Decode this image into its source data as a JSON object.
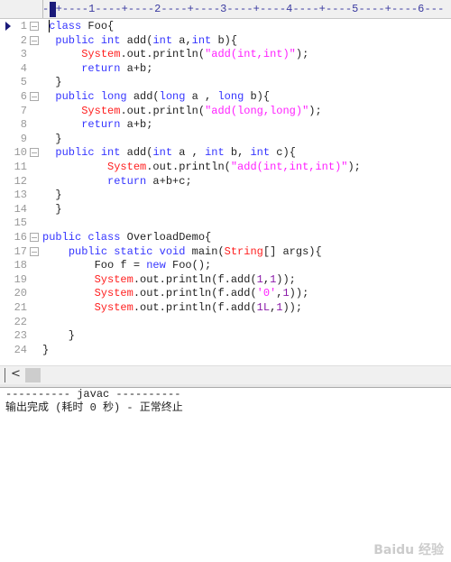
{
  "ruler": {
    "text": "--+----1----+----2----+----3----+----4----+----5----+----6---"
  },
  "editor": {
    "current_line": 1,
    "lines": [
      {
        "n": "1",
        "fold": true,
        "tokens": [
          [
            "t",
            " "
          ],
          [
            "k",
            "class"
          ],
          [
            "t",
            " Foo{"
          ]
        ]
      },
      {
        "n": "2",
        "fold": true,
        "tokens": [
          [
            "t",
            "  "
          ],
          [
            "k",
            "public int"
          ],
          [
            "t",
            " add("
          ],
          [
            "k",
            "int"
          ],
          [
            "t",
            " a,"
          ],
          [
            "k",
            "int"
          ],
          [
            "t",
            " b){"
          ]
        ]
      },
      {
        "n": "3",
        "fold": false,
        "tokens": [
          [
            "t",
            "      "
          ],
          [
            "r",
            "System"
          ],
          [
            "t",
            ".out.println("
          ],
          [
            "s",
            "\"add(int,int)\""
          ],
          [
            "t",
            ");"
          ]
        ]
      },
      {
        "n": "4",
        "fold": false,
        "tokens": [
          [
            "t",
            "      "
          ],
          [
            "k",
            "return"
          ],
          [
            "t",
            " a+b;"
          ]
        ]
      },
      {
        "n": "5",
        "fold": false,
        "tokens": [
          [
            "t",
            "  }"
          ]
        ]
      },
      {
        "n": "6",
        "fold": true,
        "tokens": [
          [
            "t",
            "  "
          ],
          [
            "k",
            "public long"
          ],
          [
            "t",
            " add("
          ],
          [
            "k",
            "long"
          ],
          [
            "t",
            " a , "
          ],
          [
            "k",
            "long"
          ],
          [
            "t",
            " b){"
          ]
        ]
      },
      {
        "n": "7",
        "fold": false,
        "tokens": [
          [
            "t",
            "      "
          ],
          [
            "r",
            "System"
          ],
          [
            "t",
            ".out.println("
          ],
          [
            "s",
            "\"add(long,long)\""
          ],
          [
            "t",
            ");"
          ]
        ]
      },
      {
        "n": "8",
        "fold": false,
        "tokens": [
          [
            "t",
            "      "
          ],
          [
            "k",
            "return"
          ],
          [
            "t",
            " a+b;"
          ]
        ]
      },
      {
        "n": "9",
        "fold": false,
        "tokens": [
          [
            "t",
            "  }"
          ]
        ]
      },
      {
        "n": "10",
        "fold": true,
        "tokens": [
          [
            "t",
            "  "
          ],
          [
            "k",
            "public int"
          ],
          [
            "t",
            " add("
          ],
          [
            "k",
            "int"
          ],
          [
            "t",
            " a , "
          ],
          [
            "k",
            "int"
          ],
          [
            "t",
            " b, "
          ],
          [
            "k",
            "int"
          ],
          [
            "t",
            " c){"
          ]
        ]
      },
      {
        "n": "11",
        "fold": false,
        "tokens": [
          [
            "t",
            "          "
          ],
          [
            "r",
            "System"
          ],
          [
            "t",
            ".out.println("
          ],
          [
            "s",
            "\"add(int,int,int)\""
          ],
          [
            "t",
            ");"
          ]
        ]
      },
      {
        "n": "12",
        "fold": false,
        "tokens": [
          [
            "t",
            "          "
          ],
          [
            "k",
            "return"
          ],
          [
            "t",
            " a+b+c;"
          ]
        ]
      },
      {
        "n": "13",
        "fold": false,
        "tokens": [
          [
            "t",
            "  }"
          ]
        ]
      },
      {
        "n": "14",
        "fold": false,
        "tokens": [
          [
            "t",
            "  }"
          ]
        ]
      },
      {
        "n": "15",
        "fold": false,
        "tokens": []
      },
      {
        "n": "16",
        "fold": true,
        "tokens": [
          [
            "k",
            "public class"
          ],
          [
            "t",
            " OverloadDemo{"
          ]
        ]
      },
      {
        "n": "17",
        "fold": true,
        "tokens": [
          [
            "t",
            "    "
          ],
          [
            "k",
            "public static void"
          ],
          [
            "t",
            " main("
          ],
          [
            "r",
            "String"
          ],
          [
            "t",
            "[] args){"
          ]
        ]
      },
      {
        "n": "18",
        "fold": false,
        "tokens": [
          [
            "t",
            "        Foo f = "
          ],
          [
            "k",
            "new"
          ],
          [
            "t",
            " Foo();"
          ]
        ]
      },
      {
        "n": "19",
        "fold": false,
        "tokens": [
          [
            "t",
            "        "
          ],
          [
            "r",
            "System"
          ],
          [
            "t",
            ".out.println(f.add("
          ],
          [
            "n",
            "1"
          ],
          [
            "t",
            ","
          ],
          [
            "n",
            "1"
          ],
          [
            "t",
            "));"
          ]
        ]
      },
      {
        "n": "20",
        "fold": false,
        "tokens": [
          [
            "t",
            "        "
          ],
          [
            "r",
            "System"
          ],
          [
            "t",
            ".out.println(f.add("
          ],
          [
            "s",
            "'0'"
          ],
          [
            "t",
            ","
          ],
          [
            "n",
            "1"
          ],
          [
            "t",
            "));"
          ]
        ]
      },
      {
        "n": "21",
        "fold": false,
        "tokens": [
          [
            "t",
            "        "
          ],
          [
            "r",
            "System"
          ],
          [
            "t",
            ".out.println(f.add("
          ],
          [
            "n",
            "1L"
          ],
          [
            "t",
            ","
          ],
          [
            "n",
            "1"
          ],
          [
            "t",
            "));"
          ]
        ]
      },
      {
        "n": "22",
        "fold": false,
        "tokens": []
      },
      {
        "n": "23",
        "fold": false,
        "tokens": [
          [
            "t",
            "    }"
          ]
        ]
      },
      {
        "n": "24",
        "fold": false,
        "tokens": [
          [
            "t",
            "}"
          ]
        ]
      }
    ]
  },
  "scrollbar": {
    "left_arrow": "<"
  },
  "output": {
    "lines": [
      "---------- javac ----------",
      "输出完成 (耗时 0 秒) - 正常终止"
    ]
  },
  "watermark": "Baidu 经验",
  "colors": {
    "keyword": "#3535ff",
    "string": "#ff20ff",
    "class_ref": "#ff2020",
    "number": "#8a1aa8"
  }
}
